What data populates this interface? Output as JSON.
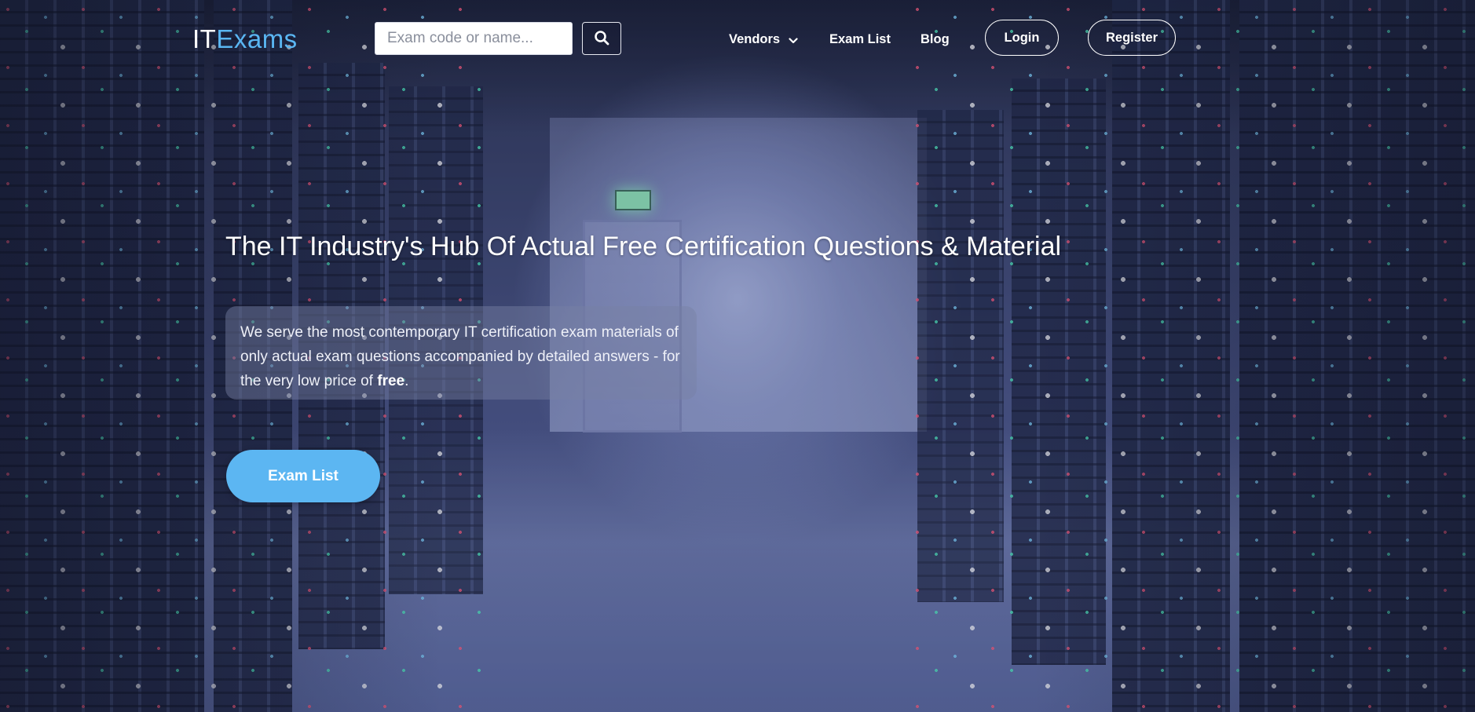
{
  "header": {
    "logo": {
      "part1": "IT",
      "part2": "Exams"
    },
    "search": {
      "placeholder": "Exam code or name...",
      "value": "",
      "button_icon": "search-icon"
    },
    "nav": {
      "vendors": {
        "label": "Vendors",
        "icon": "chevron-down-icon"
      },
      "exam_list": "Exam List",
      "blog": "Blog"
    },
    "login": "Login",
    "register": "Register"
  },
  "hero": {
    "title": "The IT Industry's Hub Of Actual Free Certification Questions & Material",
    "description_prefix": "We serve the most contemporary IT certification exam materials of only actual exam questions accompanied by detailed answers - for the very low price of ",
    "description_bold": "free",
    "description_suffix": ".",
    "cta": "Exam List"
  },
  "colors": {
    "accent": "#5cb6f2",
    "logo_secondary": "#5ab6f2",
    "text": "#ffffff"
  }
}
